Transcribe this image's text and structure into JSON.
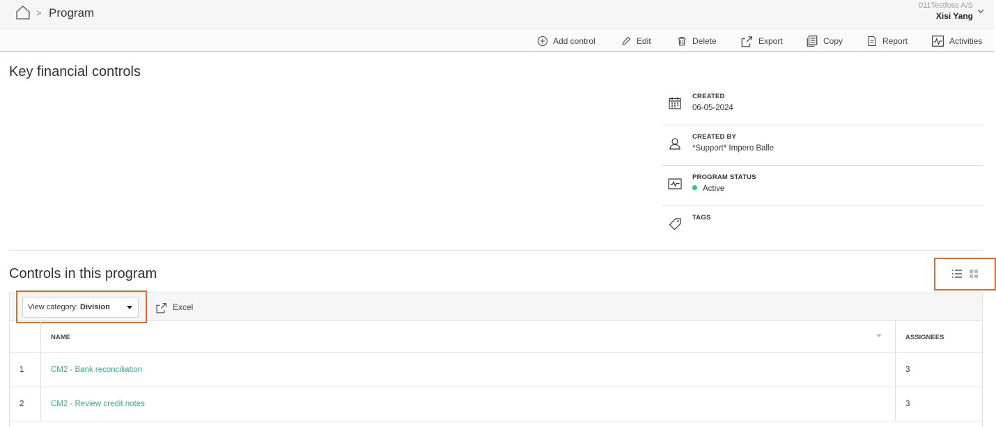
{
  "header": {
    "breadcrumb_separator": ">",
    "title": "Program",
    "organization": "011Testfoss A/S",
    "user_name": "Xisi Yang"
  },
  "toolbar": {
    "items": [
      {
        "label": "Add control",
        "icon": "plus-circle-icon"
      },
      {
        "label": "Edit",
        "icon": "pencil-icon"
      },
      {
        "label": "Delete",
        "icon": "trash-icon"
      },
      {
        "label": "Export",
        "icon": "export-icon"
      },
      {
        "label": "Copy",
        "icon": "copy-icon"
      },
      {
        "label": "Report",
        "icon": "report-icon"
      },
      {
        "label": "Activities",
        "icon": "activity-icon"
      }
    ]
  },
  "program": {
    "title": "Key financial controls"
  },
  "meta": {
    "created_label": "CREATED",
    "created_value": "06-05-2024",
    "created_by_label": "CREATED BY",
    "created_by_value": "*Support* Impero Balle",
    "status_label": "PROGRAM STATUS",
    "status_value": "Active",
    "status_color": "#2ecc71",
    "tags_label": "TAGS"
  },
  "controls": {
    "title": "Controls in this program",
    "view_category_prefix": "View category:",
    "view_category_value": "Division",
    "excel_label": "Excel",
    "columns": {
      "name": "NAME",
      "assignees": "ASSIGNEES"
    },
    "rows": [
      {
        "num": "1",
        "name": "CM2 - Bank reconciliation",
        "assignees": "3"
      },
      {
        "num": "2",
        "name": "CM2 - Review credit notes",
        "assignees": "3"
      }
    ]
  },
  "colors": {
    "accent_link": "#3aa88a",
    "highlight_border": "#e36a2a"
  }
}
